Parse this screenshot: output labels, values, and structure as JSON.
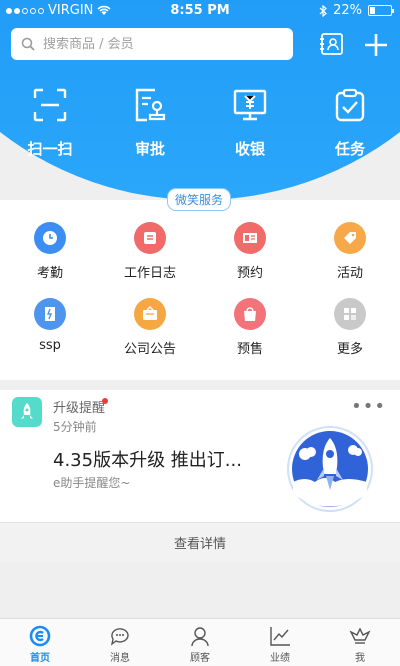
{
  "status_bar": {
    "carrier": "VIRGIN",
    "time": "8:55 PM",
    "battery": "22%"
  },
  "search": {
    "placeholder": "搜索商品 / 会员"
  },
  "quick_actions": [
    {
      "label": "扫一扫",
      "icon": "scan-icon"
    },
    {
      "label": "审批",
      "icon": "approval-icon"
    },
    {
      "label": "收银",
      "icon": "cashier-icon"
    },
    {
      "label": "任务",
      "icon": "task-icon"
    }
  ],
  "section_tag": "微笑服务",
  "services": [
    {
      "label": "考勤",
      "icon": "clock-icon",
      "color": "#3d8ef2"
    },
    {
      "label": "工作日志",
      "icon": "worklog-icon",
      "color": "#f06a6a"
    },
    {
      "label": "预约",
      "icon": "appointment-icon",
      "color": "#f26b6b"
    },
    {
      "label": "活动",
      "icon": "tag-icon",
      "color": "#f7a94a"
    },
    {
      "label": "ssp",
      "icon": "ssp-icon",
      "color": "#4e95ee"
    },
    {
      "label": "公司公告",
      "icon": "notice-icon",
      "color": "#f5a842"
    },
    {
      "label": "预售",
      "icon": "presale-icon",
      "color": "#f2747a"
    },
    {
      "label": "更多",
      "icon": "more-grid-icon",
      "color": "#c9c9c9"
    }
  ],
  "card": {
    "title": "升级提醒",
    "time": "5分钟前",
    "headline": "4.35版本升级  推出订...",
    "subtitle": "e助手提醒您~",
    "more": "•••"
  },
  "detail_link": "查看详情",
  "tabs": [
    {
      "label": "首页",
      "icon": "home-icon",
      "active": true
    },
    {
      "label": "消息",
      "icon": "message-icon"
    },
    {
      "label": "顾客",
      "icon": "customer-icon"
    },
    {
      "label": "业绩",
      "icon": "chart-icon"
    },
    {
      "label": "我",
      "icon": "crown-icon"
    }
  ],
  "colors": {
    "primary": "#1a8cf3",
    "card_icon": "#55dbc9",
    "alert": "#f03a3a"
  }
}
